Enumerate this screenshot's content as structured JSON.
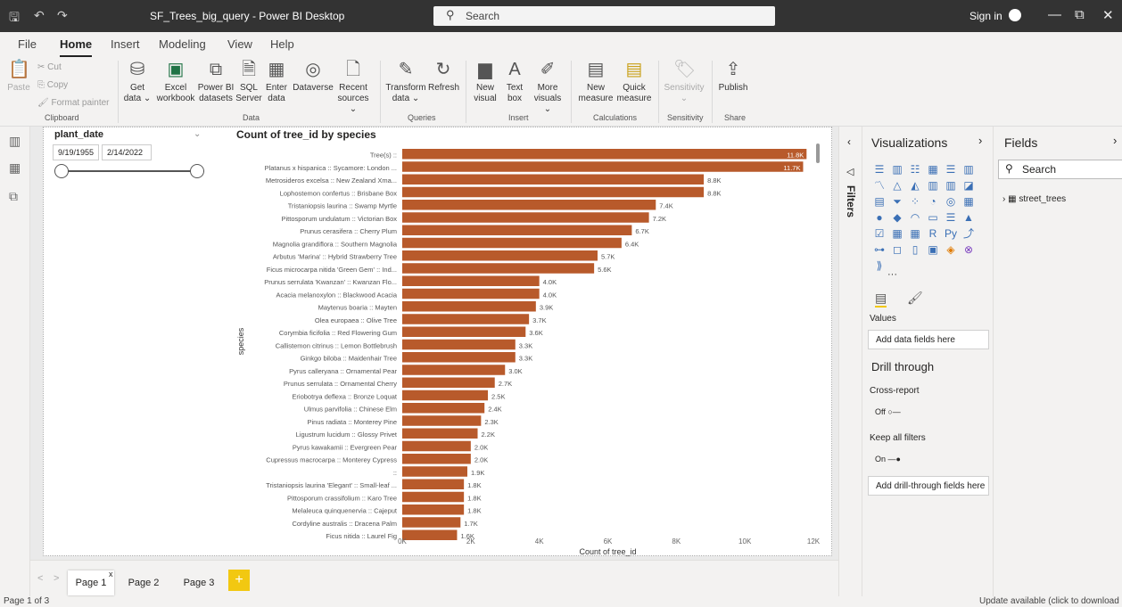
{
  "titlebar": {
    "title": "SF_Trees_big_query - Power BI Desktop",
    "search": "Search",
    "signin": "Sign in",
    "min": "—",
    "restore": "⧉",
    "close": "✕"
  },
  "menu": [
    "File",
    "Home",
    "Insert",
    "Modeling",
    "View",
    "Help"
  ],
  "ribbon": {
    "clipboard": {
      "paste": "Paste",
      "cut": "Cut",
      "copy": "Copy",
      "format_painter": "Format painter",
      "group": "Clipboard"
    },
    "data": {
      "get_data": "Get data ⌄",
      "excel": "Excel workbook",
      "pbi_datasets": "Power BI datasets",
      "sql": "SQL Server",
      "enter_data": "Enter data",
      "dataverse": "Dataverse",
      "recent": "Recent sources ⌄",
      "group": "Data"
    },
    "queries": {
      "transform": "Transform data ⌄",
      "refresh": "Refresh",
      "group": "Queries"
    },
    "insert": {
      "new_visual": "New visual",
      "text_box": "Text box",
      "more_visuals": "More visuals ⌄",
      "group": "Insert"
    },
    "calculations": {
      "new_measure": "New measure",
      "quick_measure": "Quick measure",
      "group": "Calculations"
    },
    "sensitivity": {
      "label": "Sensitivity ⌄",
      "group": "Sensitivity"
    },
    "share": {
      "publish": "Publish",
      "group": "Share"
    }
  },
  "slicer": {
    "title": "plant_date",
    "start": "9/19/1955",
    "end": "2/14/2022"
  },
  "chart_data": {
    "type": "bar",
    "orientation": "horizontal",
    "title": "Count of tree_id by species",
    "xlabel": "Count of tree_id",
    "ylabel": "species",
    "xlim": [
      0,
      12000
    ],
    "xticks": [
      "0K",
      "2K",
      "4K",
      "6K",
      "8K",
      "10K",
      "12K"
    ],
    "bar_color": "#b85a2b",
    "categories": [
      "Tree(s) ::",
      "Platanus x hispanica :: Sycamore: London ...",
      "Metrosideros excelsa :: New Zealand Xma...",
      "Lophostemon confertus :: Brisbane Box",
      "Tristaniopsis laurina :: Swamp Myrtle",
      "Pittosporum undulatum :: Victorian Box",
      "Prunus cerasifera :: Cherry Plum",
      "Magnolia grandiflora :: Southern Magnolia",
      "Arbutus 'Marina' :: Hybrid Strawberry Tree",
      "Ficus microcarpa nitida 'Green Gem' :: Ind...",
      "Prunus serrulata 'Kwanzan' :: Kwanzan Flo...",
      "Acacia melanoxylon :: Blackwood Acacia",
      "Maytenus boaria :: Mayten",
      "Olea europaea :: Olive Tree",
      "Corymbia ficifolia :: Red Flowering Gum",
      "Callistemon citrinus :: Lemon Bottlebrush",
      "Ginkgo biloba :: Maidenhair Tree",
      "Pyrus calleryana :: Ornamental Pear",
      "Prunus serrulata :: Ornamental Cherry",
      "Eriobotrya deflexa :: Bronze Loquat",
      "Ulmus parvifolia :: Chinese Elm",
      "Pinus radiata :: Monterey Pine",
      "Ligustrum lucidum :: Glossy Privet",
      "Pyrus kawakamii :: Evergreen Pear",
      "Cupressus macrocarpa :: Monterey Cypress",
      "::",
      "Tristaniopsis laurina 'Elegant' :: Small-leaf ...",
      "Pittosporum crassifolium :: Karo Tree",
      "Melaleuca quinquenervia :: Cajeput",
      "Cordyline australis :: Dracena Palm",
      "Ficus nitida :: Laurel Fig"
    ],
    "values": [
      11800,
      11700,
      8800,
      8800,
      7400,
      7200,
      6700,
      6400,
      5700,
      5600,
      4000,
      4000,
      3900,
      3700,
      3600,
      3300,
      3300,
      3000,
      2700,
      2500,
      2400,
      2300,
      2200,
      2000,
      2000,
      1900,
      1800,
      1800,
      1800,
      1700,
      1600
    ],
    "labels": [
      "11.8K",
      "11.7K",
      "8.8K",
      "8.8K",
      "7.4K",
      "7.2K",
      "6.7K",
      "6.4K",
      "5.7K",
      "5.6K",
      "4.0K",
      "4.0K",
      "3.9K",
      "3.7K",
      "3.6K",
      "3.3K",
      "3.3K",
      "3.0K",
      "2.7K",
      "2.5K",
      "2.4K",
      "2.3K",
      "2.2K",
      "2.0K",
      "2.0K",
      "1.9K",
      "1.8K",
      "1.8K",
      "1.8K",
      "1.7K",
      "1.6K"
    ]
  },
  "pages": {
    "tabs": [
      "Page 1",
      "Page 2",
      "Page 3"
    ],
    "close": "x",
    "add": "+",
    "prev": "<",
    "next": ">"
  },
  "status": {
    "left": "Page 1 of 3",
    "right": "Update available (click to download"
  },
  "filters": {
    "label": "Filters"
  },
  "viz": {
    "title": "Visualizations",
    "values_label": "Values",
    "add_data": "Add data fields here",
    "drill_title": "Drill through",
    "cross_report": "Cross-report",
    "off": "Off",
    "keep_filters": "Keep all filters",
    "on": "On",
    "add_drill": "Add drill-through fields here",
    "more": "···"
  },
  "fields": {
    "title": "Fields",
    "search": "Search",
    "table": "street_trees"
  }
}
